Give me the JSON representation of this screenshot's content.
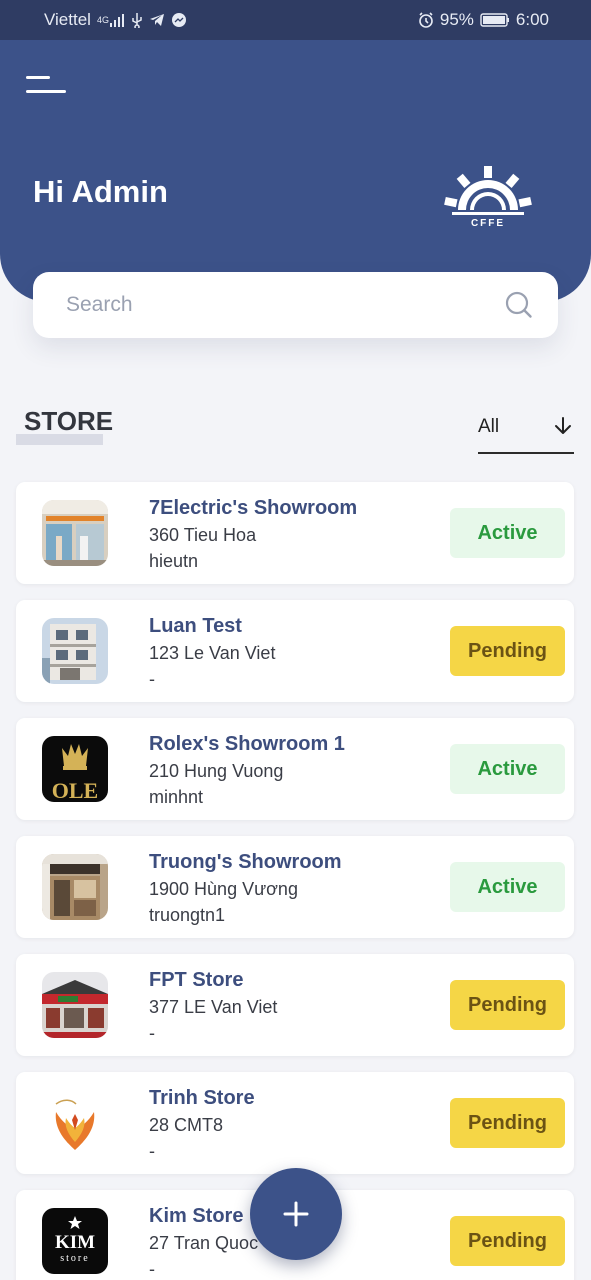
{
  "status_bar": {
    "carrier": "Viettel",
    "network": "4G",
    "battery": "95%",
    "time": "6:00"
  },
  "header": {
    "greeting": "Hi Admin",
    "logo_text": "CFFE"
  },
  "search": {
    "placeholder": "Search",
    "value": ""
  },
  "section": {
    "title": "STORE"
  },
  "filter": {
    "selected": "All"
  },
  "stores": [
    {
      "name": "7Electric's Showroom",
      "address": "360 Tieu Hoa",
      "owner": "hieutn",
      "status": "Active"
    },
    {
      "name": "Luan Test",
      "address": "123 Le Van Viet",
      "owner": "-",
      "status": "Pending"
    },
    {
      "name": "Rolex's Showroom 1",
      "address": "210 Hung Vuong",
      "owner": "minhnt",
      "status": "Active"
    },
    {
      "name": "Truong's Showroom",
      "address": "1900 Hùng Vương",
      "owner": "truongtn1",
      "status": "Active"
    },
    {
      "name": "FPT Store",
      "address": "377 LE Van Viet",
      "owner": "-",
      "status": "Pending"
    },
    {
      "name": "Trinh Store",
      "address": "28 CMT8",
      "owner": "-",
      "status": "Pending"
    },
    {
      "name": "Kim Store",
      "address": "27 Tran Quoc",
      "owner": "-",
      "status": "Pending"
    }
  ],
  "thumb_text": {
    "rolex": "OLE",
    "kim_top": "KIM",
    "kim_bottom": "store"
  },
  "colors": {
    "brand": "#3c5289",
    "active_bg": "#e7f8ea",
    "active_text": "#2a9a3e",
    "pending_bg": "#f5d646",
    "pending_text": "#6b5314"
  },
  "icons": {
    "menu": "menu-icon",
    "search": "search-icon",
    "filter": "arrow-down-icon",
    "fab": "plus-icon"
  }
}
